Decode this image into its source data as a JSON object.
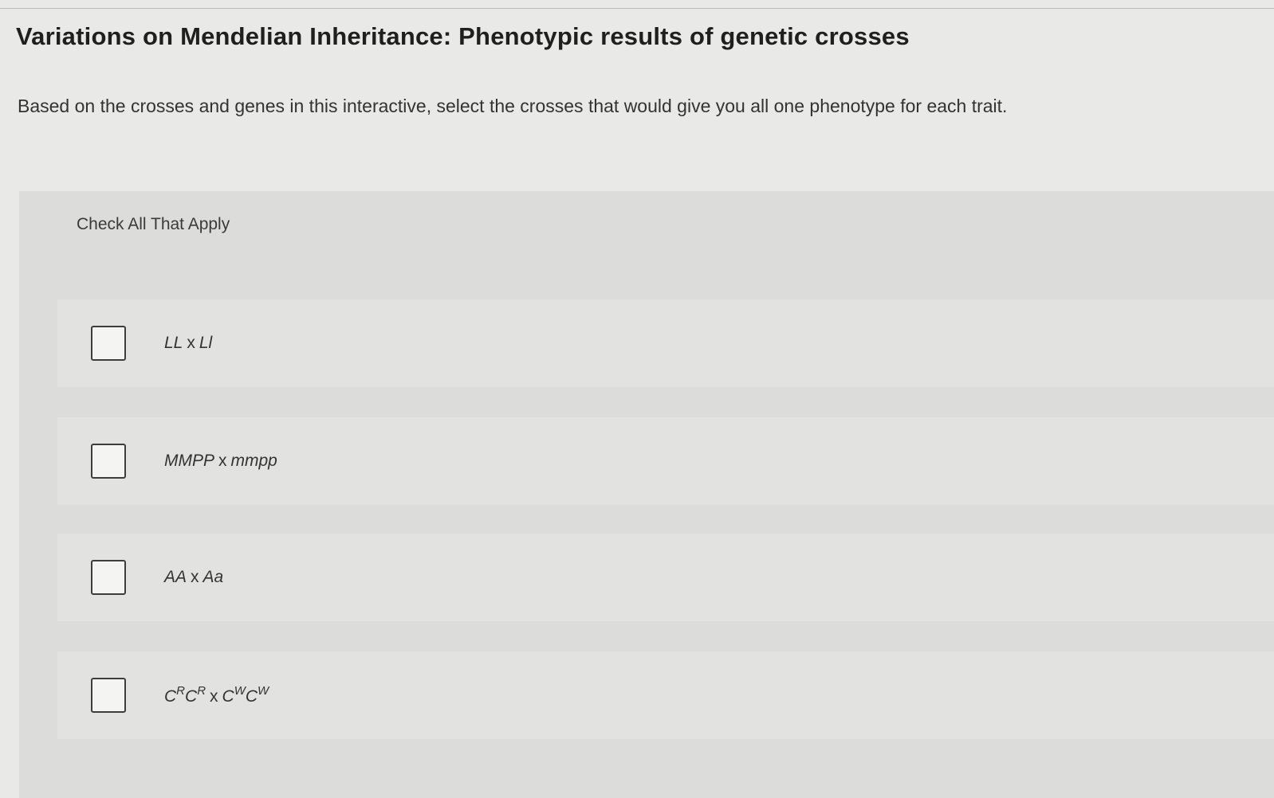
{
  "page": {
    "title": "Variations on Mendelian Inheritance: Phenotypic results of genetic crosses",
    "instructions": "Based on the crosses and genes in this interactive, select the crosses that would give you all one phenotype for each trait."
  },
  "question": {
    "check_all_label": "Check All That Apply",
    "times_symbol": "x",
    "options": [
      {
        "checked": false,
        "left": "LL",
        "right": "Ll"
      },
      {
        "checked": false,
        "left": "MMPP",
        "right": "mmpp"
      },
      {
        "checked": false,
        "left": "AA",
        "right": "Aa"
      },
      {
        "checked": false,
        "left_parts": [
          {
            "base": "C",
            "sup": "R"
          },
          {
            "base": "C",
            "sup": "R"
          }
        ],
        "right_parts": [
          {
            "base": "C",
            "sup": "W"
          },
          {
            "base": "C",
            "sup": "W"
          }
        ]
      }
    ]
  }
}
